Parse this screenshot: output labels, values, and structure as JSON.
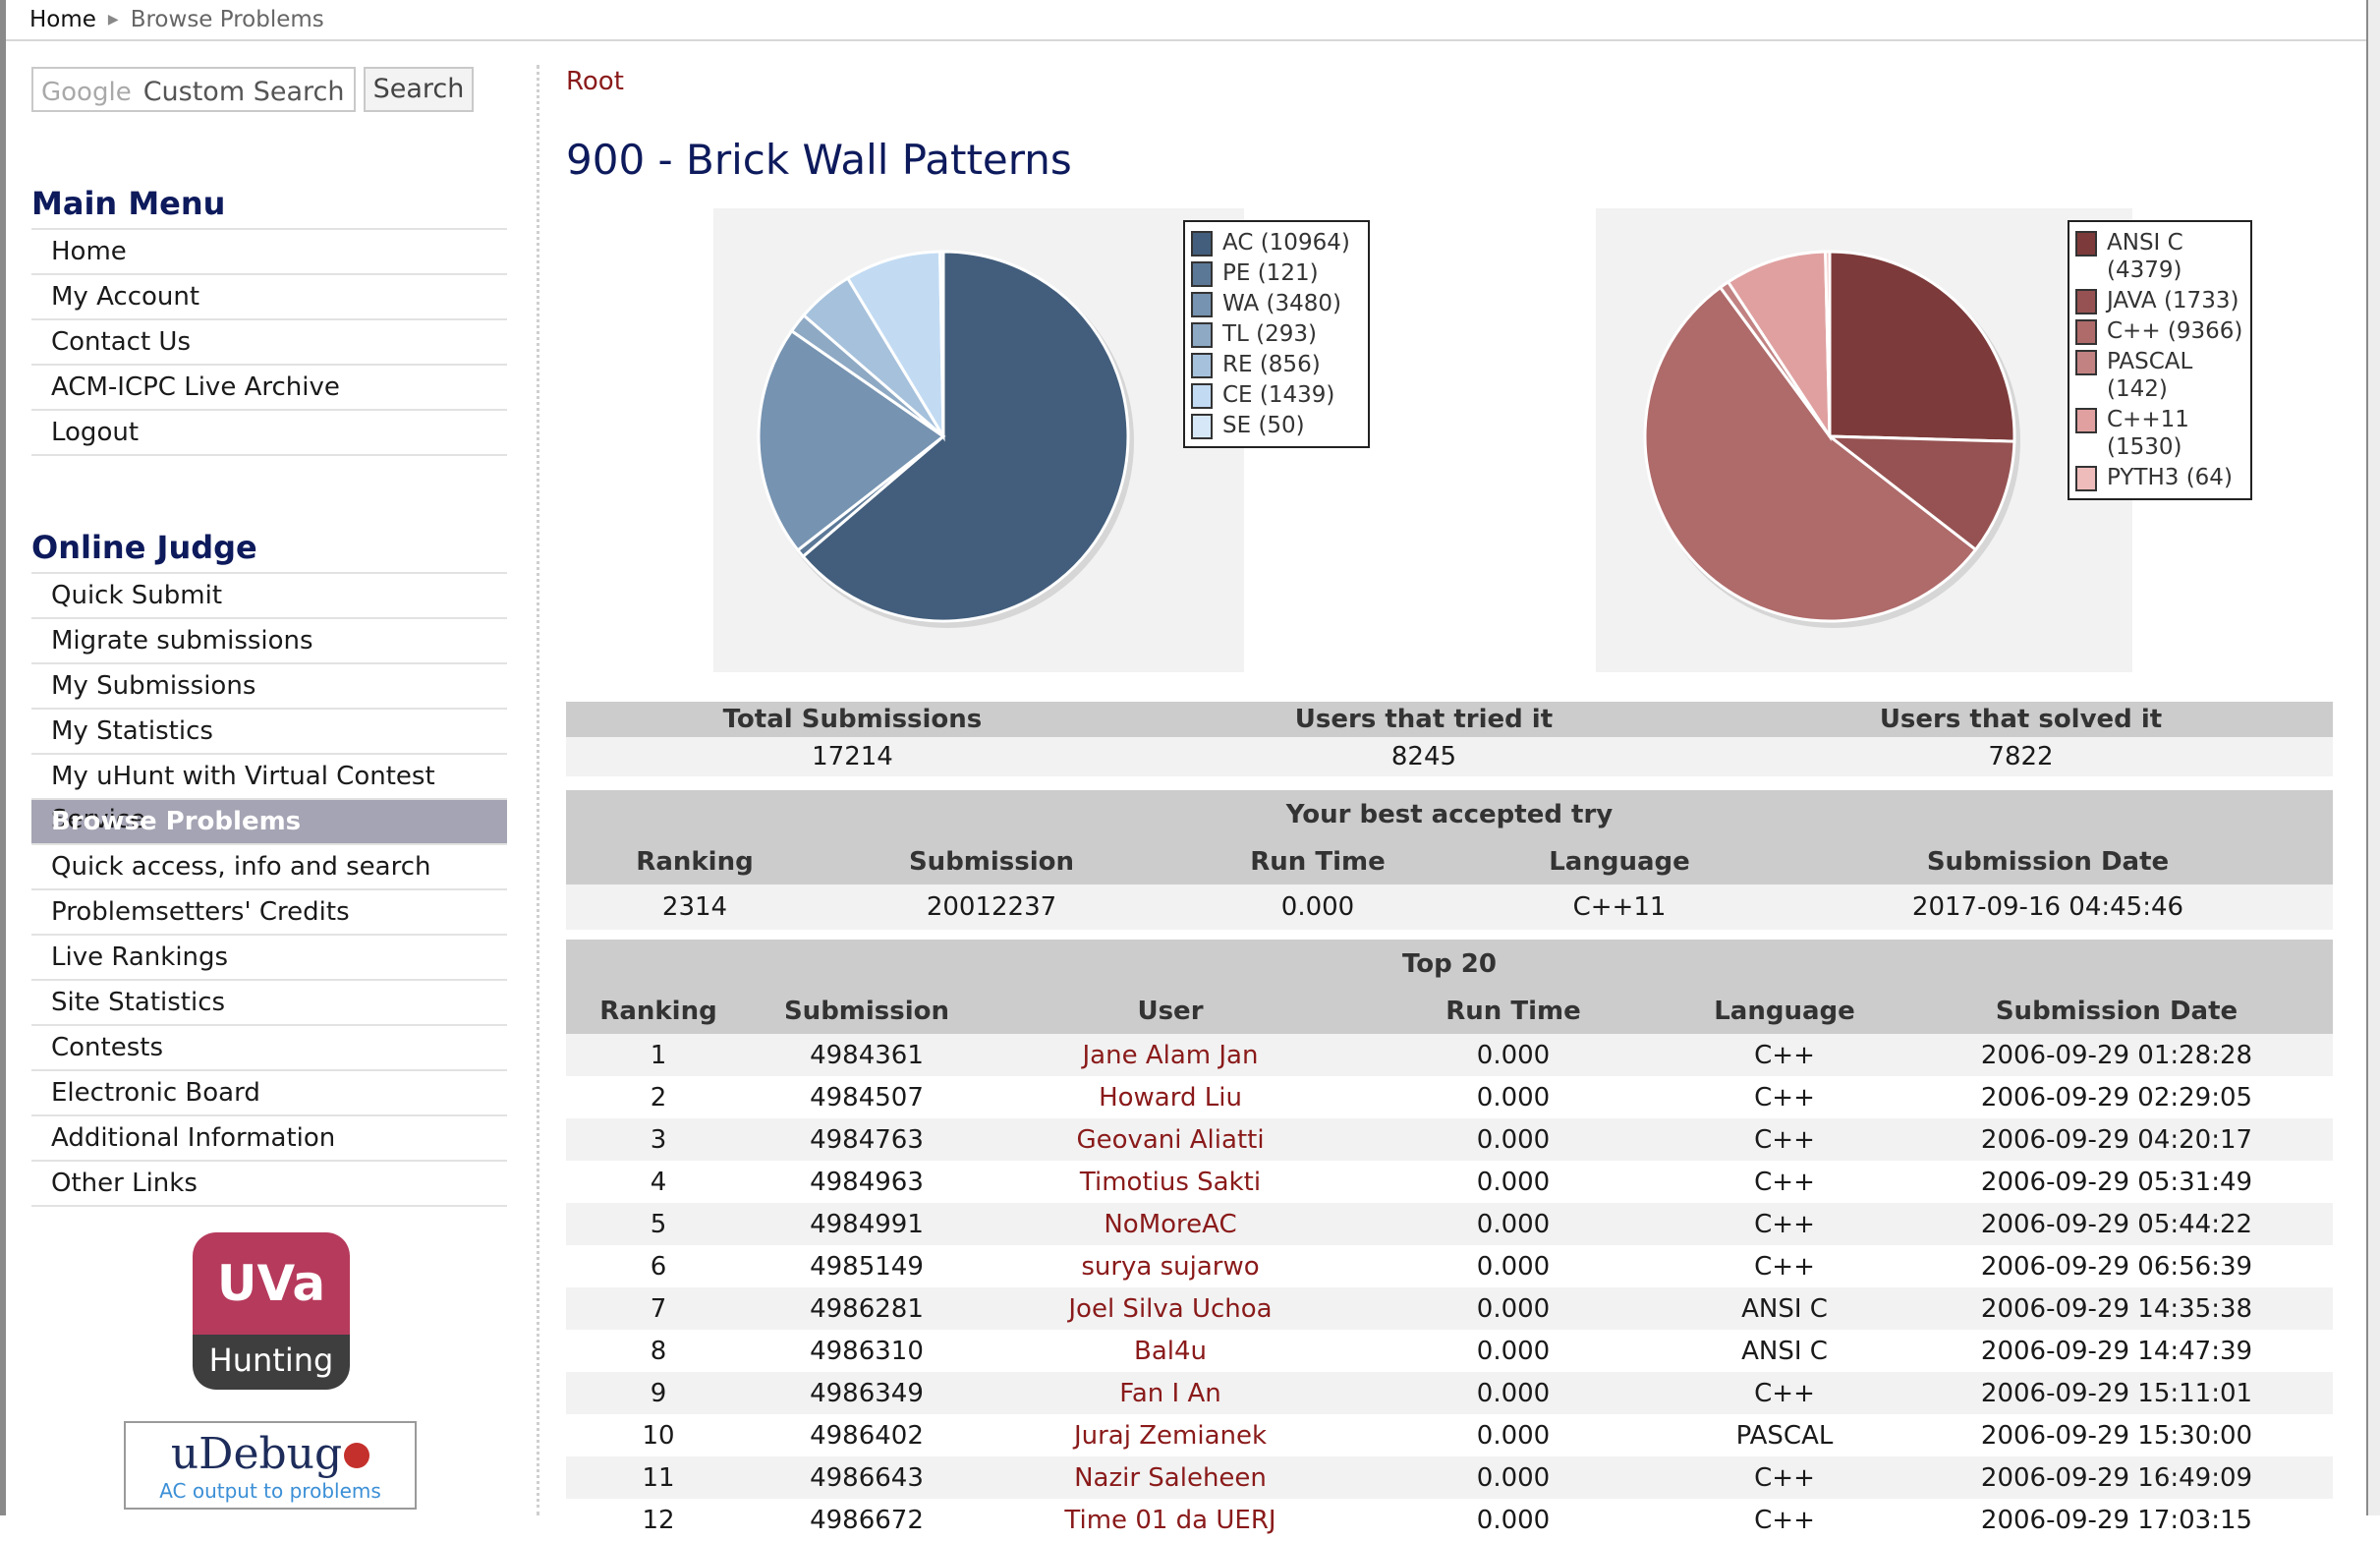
{
  "breadcrumb": {
    "home": "Home",
    "current": "Browse Problems"
  },
  "search": {
    "brand": "Google",
    "placeholder": "Custom Search",
    "button": "Search"
  },
  "main_menu": {
    "heading": "Main Menu",
    "items": [
      "Home",
      "My Account",
      "Contact Us",
      "ACM-ICPC Live Archive",
      "Logout"
    ]
  },
  "online_judge": {
    "heading": "Online Judge",
    "items": [
      "Quick Submit",
      "Migrate submissions",
      "My Submissions",
      "My Statistics",
      "My uHunt with Virtual Contest Service",
      "Browse Problems",
      "Quick access, info and search",
      "Problemsetters' Credits",
      "Live Rankings",
      "Site Statistics",
      "Contests",
      "Electronic Board",
      "Additional Information",
      "Other Links"
    ],
    "active": "Browse Problems"
  },
  "badges": {
    "uva_top": "UVa",
    "uva_bottom": "Hunting",
    "udebug_name": "uDebug",
    "udebug_tag": "AC output to problems"
  },
  "root_link": "Root",
  "problem_title": "900 - Brick Wall Patterns",
  "chart_data": [
    {
      "type": "pie",
      "title": "",
      "legend_position": "top-right",
      "slices": [
        {
          "label": "AC (10964)",
          "value": 10964,
          "color": "#435e7c"
        },
        {
          "label": "PE (121)",
          "value": 121,
          "color": "#5b7897"
        },
        {
          "label": "WA (3480)",
          "value": 3480,
          "color": "#7693b1"
        },
        {
          "label": "TL (293)",
          "value": 293,
          "color": "#8ea9c4"
        },
        {
          "label": "RE (856)",
          "value": 856,
          "color": "#a6c1dc"
        },
        {
          "label": "CE (1439)",
          "value": 1439,
          "color": "#c2dbf3"
        },
        {
          "label": "SE (50)",
          "value": 50,
          "color": "#d6e8f8"
        }
      ]
    },
    {
      "type": "pie",
      "title": "",
      "legend_position": "top-right",
      "slices": [
        {
          "label": "ANSI C (4379)",
          "value": 4379,
          "color": "#7d3a3a"
        },
        {
          "label": "JAVA (1733)",
          "value": 1733,
          "color": "#965252"
        },
        {
          "label": "C++ (9366)",
          "value": 9366,
          "color": "#af6a6a"
        },
        {
          "label": "PASCAL (142)",
          "value": 142,
          "color": "#c28282"
        },
        {
          "label": "C++11 (1530)",
          "value": 1530,
          "color": "#e0a0a0"
        },
        {
          "label": "PYTH3 (64)",
          "value": 64,
          "color": "#efbcbc"
        }
      ]
    }
  ],
  "stats": {
    "headers": [
      "Total Submissions",
      "Users that tried it",
      "Users that solved it"
    ],
    "values": [
      "17214",
      "8245",
      "7822"
    ]
  },
  "best_try": {
    "title": "Your best accepted try",
    "headers": [
      "Ranking",
      "Submission",
      "Run Time",
      "Language",
      "Submission Date"
    ],
    "values": [
      "2314",
      "20012237",
      "0.000",
      "C++11",
      "2017-09-16 04:45:46"
    ]
  },
  "top20": {
    "title": "Top 20",
    "headers": [
      "Ranking",
      "Submission",
      "User",
      "Run Time",
      "Language",
      "Submission Date"
    ],
    "rows": [
      [
        "1",
        "4984361",
        "Jane Alam Jan",
        "0.000",
        "C++",
        "2006-09-29 01:28:28"
      ],
      [
        "2",
        "4984507",
        "Howard Liu",
        "0.000",
        "C++",
        "2006-09-29 02:29:05"
      ],
      [
        "3",
        "4984763",
        "Geovani Aliatti",
        "0.000",
        "C++",
        "2006-09-29 04:20:17"
      ],
      [
        "4",
        "4984963",
        "Timotius Sakti",
        "0.000",
        "C++",
        "2006-09-29 05:31:49"
      ],
      [
        "5",
        "4984991",
        "NoMoreAC",
        "0.000",
        "C++",
        "2006-09-29 05:44:22"
      ],
      [
        "6",
        "4985149",
        "surya sujarwo",
        "0.000",
        "C++",
        "2006-09-29 06:56:39"
      ],
      [
        "7",
        "4986281",
        "Joel Silva Uchoa",
        "0.000",
        "ANSI C",
        "2006-09-29 14:35:38"
      ],
      [
        "8",
        "4986310",
        "Bal4u",
        "0.000",
        "ANSI C",
        "2006-09-29 14:47:39"
      ],
      [
        "9",
        "4986349",
        "Fan I An",
        "0.000",
        "C++",
        "2006-09-29 15:11:01"
      ],
      [
        "10",
        "4986402",
        "Juraj Zemianek",
        "0.000",
        "PASCAL",
        "2006-09-29 15:30:00"
      ],
      [
        "11",
        "4986643",
        "Nazir Saleheen",
        "0.000",
        "C++",
        "2006-09-29 16:49:09"
      ],
      [
        "12",
        "4986672",
        "Time 01 da UERJ",
        "0.000",
        "C++",
        "2006-09-29 17:03:15"
      ]
    ]
  }
}
